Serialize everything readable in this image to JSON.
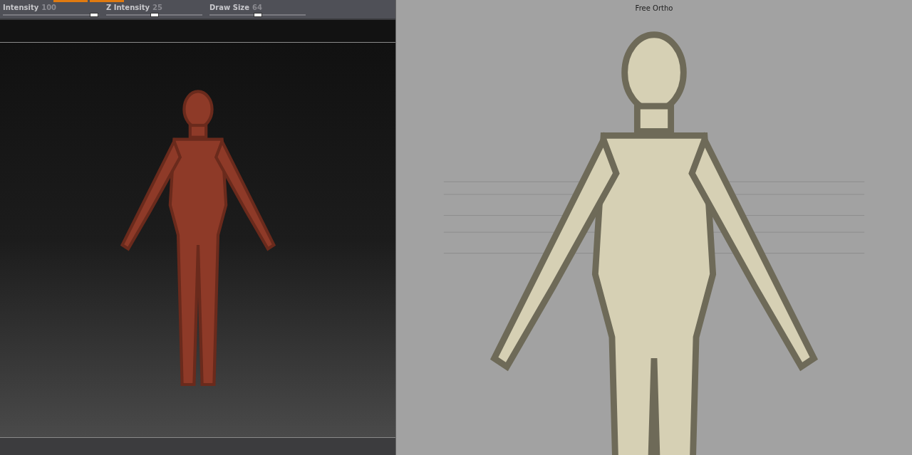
{
  "sculpt_toolbar": {
    "sliders": [
      {
        "label": "Intensity",
        "reading": "100",
        "level": 0.95
      },
      {
        "label": "Z Intensity",
        "reading": "25",
        "level": 0.5
      },
      {
        "label": "Draw Size",
        "reading": "64",
        "level": 0.5
      }
    ]
  },
  "perspective_viewport": {
    "label": "Free Ortho"
  }
}
